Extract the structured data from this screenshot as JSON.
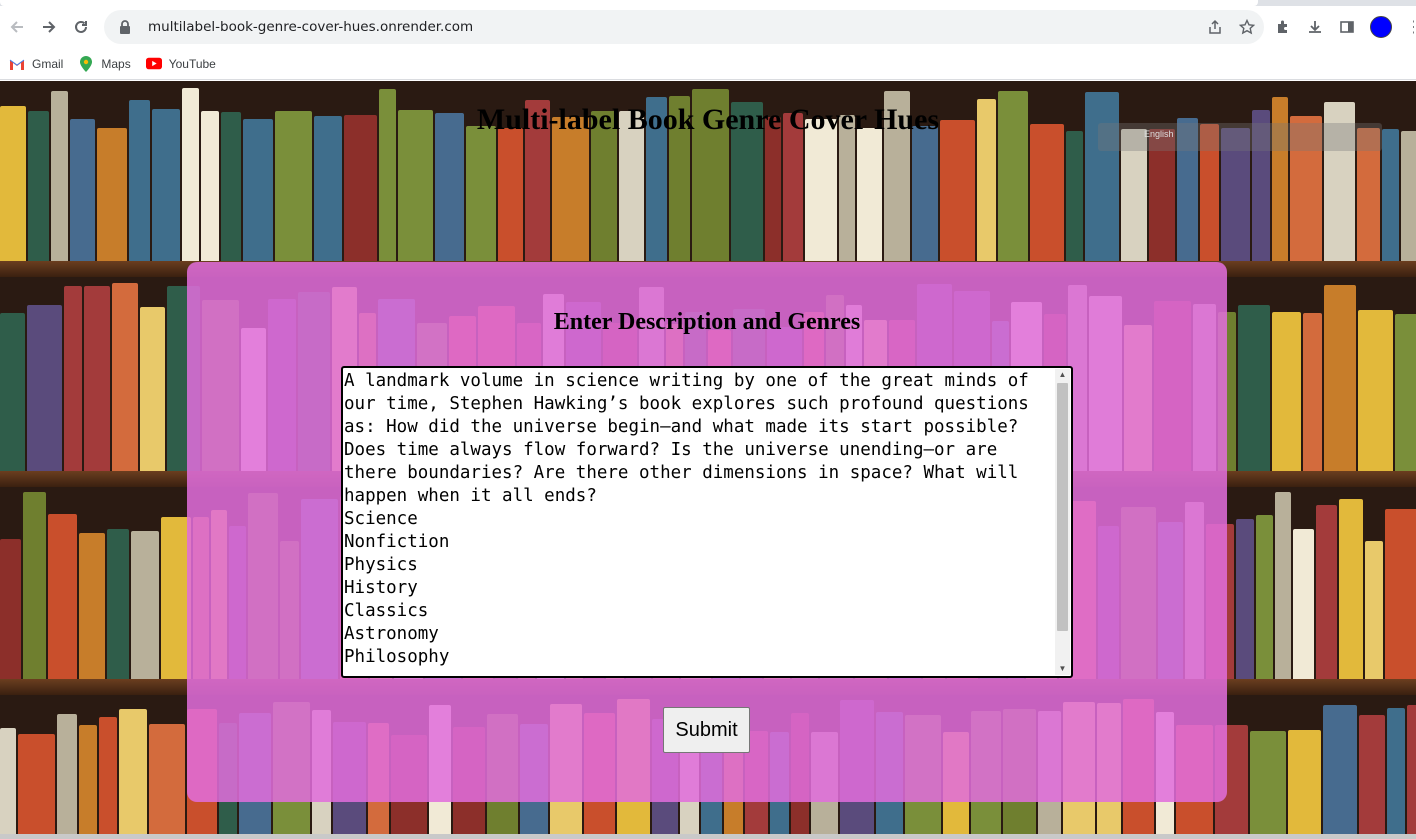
{
  "browser": {
    "url": "multilabel-book-genre-cover-hues.onrender.com",
    "bookmarks": [
      {
        "label": "Gmail",
        "icon": "gmail-icon"
      },
      {
        "label": "Maps",
        "icon": "maps-icon"
      },
      {
        "label": "YouTube",
        "icon": "youtube-icon"
      }
    ]
  },
  "page": {
    "title": "Multi-label Book Genre Cover Hues",
    "form_title": "Enter Description and Genres",
    "description": "A landmark volume in science writing by one of the great minds of our time, Stephen Hawking’s book explores such profound questions as: How did the universe begin—and what made its start possible? Does time always flow forward? Is the universe unending—or are there boundaries? Are there other dimensions in space? What will happen when it all ends?\nScience\nNonfiction\nPhysics\nHistory\nClassics\nAstronomy\nPhilosophy",
    "submit_label": "Submit",
    "translate_label": "English"
  },
  "colors": {
    "overlay": "#e16edc",
    "avatar": "#0000ff"
  }
}
